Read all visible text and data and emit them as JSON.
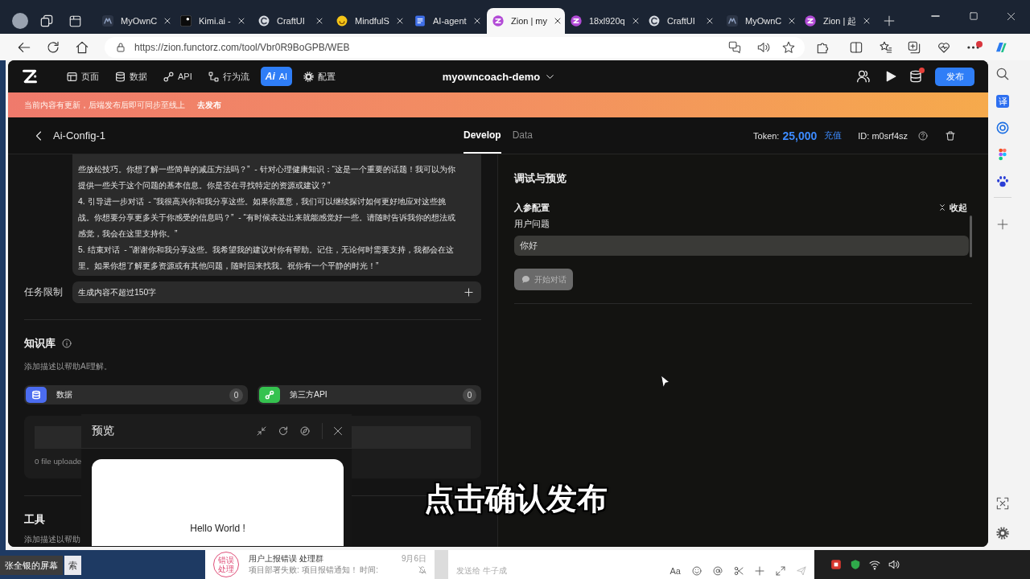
{
  "browser": {
    "tabs": [
      {
        "kind": "dark",
        "title": "MyOwnC",
        "selected": false
      },
      {
        "kind": "square",
        "title": "Kimi.ai -",
        "selected": false
      },
      {
        "kind": "swirl",
        "title": "CraftUI",
        "selected": false
      },
      {
        "kind": "smiley",
        "title": "MindfulS",
        "selected": false
      },
      {
        "kind": "doc",
        "title": "AI-agent",
        "selected": false
      },
      {
        "kind": "zion",
        "title": "Zion | my",
        "selected": true
      },
      {
        "kind": "zion",
        "title": "18xl920q",
        "selected": false
      },
      {
        "kind": "swirl",
        "title": "CraftUI",
        "selected": false
      },
      {
        "kind": "dark",
        "title": "MyOwnC",
        "selected": false
      },
      {
        "kind": "zion",
        "title": "Zion | 起",
        "selected": false
      }
    ],
    "address": "https://zion.functorz.com/tool/Vbr0R9BoGPB/WEB",
    "menu_alert": true,
    "sidebar": {
      "translate": "译"
    }
  },
  "app": {
    "nav": [
      {
        "kind": "page",
        "label": "页面",
        "selected": false
      },
      {
        "kind": "data",
        "label": "数据",
        "selected": false
      },
      {
        "kind": "api",
        "label": "API",
        "selected": false
      },
      {
        "kind": "flow",
        "label": "行为流",
        "selected": false
      },
      {
        "kind": "ai",
        "icon_text": "Ai",
        "label": "AI",
        "selected": true
      },
      {
        "kind": "settings",
        "label": "配置",
        "selected": false
      }
    ],
    "project": "myowncoach-demo",
    "alert": true,
    "publish": "发布"
  },
  "banner": {
    "message": "当前内容有更新，后端发布后即可同步至线上",
    "action": "去发布"
  },
  "config": {
    "title": "Ai-Config-1",
    "tabs": [
      {
        "label": "Develop",
        "selected": true
      },
      {
        "label": "Data",
        "selected": false
      }
    ],
    "token_label": "Token:",
    "token": "25,000",
    "recharge": "充值",
    "id": "ID: m0srf4sz"
  },
  "prompt": {
    "paragraphs": [
      "些放松技巧。你想了解一些简单的减压方法吗？”  - 针对心理健康知识：“这是一个重要的话题！我可以为你提供一些关于这个问题的基本信息。你是否在寻找特定的资源或建议？”",
      "4. 引导进一步对话  - “我很高兴你和我分享这些。如果你愿意，我们可以继续探讨如何更好地应对这些挑战。你想要分享更多关于你感受的信息吗？”  - “有时候表达出来就能感觉好一些。请随时告诉我你的想法或感觉，我会在这里支持你。”",
      "5. 结束对话  - “谢谢你和我分享这些。我希望我的建议对你有帮助。记住，无论何时需要支持，我都会在这里。如果你想了解更多资源或有其他问题，随时回来找我。祝你有一个平静的时光！”"
    ]
  },
  "task_limit": {
    "label": "任务限制",
    "value": "生成内容不超过150字"
  },
  "knowledge": {
    "title": "知识库",
    "description": "添加描述以帮助AI理解。",
    "sources": [
      {
        "kind": "data",
        "label": "数据",
        "count": "0"
      },
      {
        "kind": "api",
        "label": "第三方API",
        "count": "0"
      }
    ],
    "upload_status": "0 file uploade"
  },
  "tools": {
    "title": "工具",
    "description": "添加描述以帮助"
  },
  "preview": {
    "title": "预览",
    "content": "Hello World !"
  },
  "debug": {
    "title": "调试与预览",
    "section": "入参配置",
    "collapse": "收起",
    "field_label": "用户问题",
    "value": "你好",
    "start_button": {
      "label": "开始对话",
      "disabled": true
    }
  },
  "subtitle": "点击确认发布",
  "desktop": {
    "screen_label": "张全银的屏幕",
    "search": {
      "placeholder": "索"
    },
    "chat": {
      "avatar": "错误处理",
      "title": "用户上报错误 处理群",
      "date": "9月6日",
      "preview": "项目部署失败: 项目报错通知！ 时间:"
    },
    "compose": {
      "placeholder": "发送给 牛子成",
      "format_label": "Aa"
    }
  }
}
